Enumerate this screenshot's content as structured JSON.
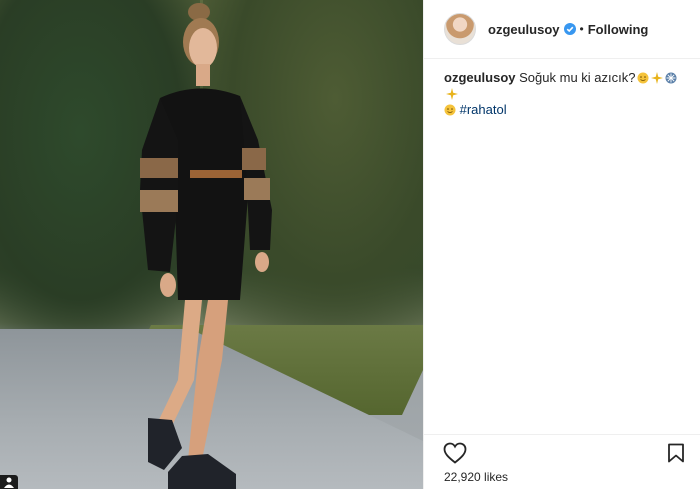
{
  "post": {
    "username": "ozgeulusoy",
    "follow_state": "Following",
    "separator": "•",
    "caption_text": "Soğuk mu ki azıcık?",
    "hashtag": "#rahatol",
    "likes": "22,920 likes"
  },
  "colors": {
    "verified": "#3897f0",
    "hashtag": "#003569",
    "text": "#262626"
  },
  "icons": {
    "verified": "verified-badge-icon",
    "like": "heart-icon",
    "save": "bookmark-icon"
  }
}
